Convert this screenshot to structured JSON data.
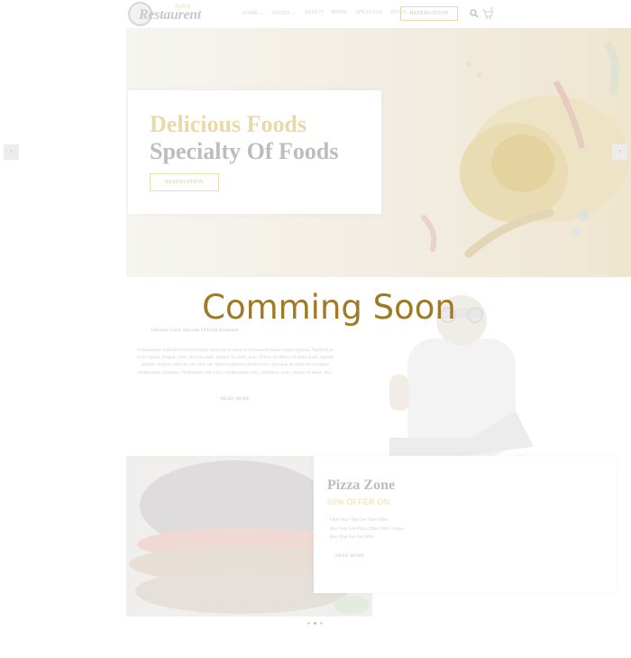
{
  "header": {
    "logo_text": "Restaurent",
    "logo_tag": "Spicy",
    "nav": [
      "HOME ⌄",
      "PAGES ⌄",
      "ABOUT",
      "MENU",
      "SPEACIAL",
      "NEWS"
    ],
    "reservation_label": "RESERVATION",
    "cart_count": "0",
    "icons": {
      "search": "search-icon",
      "cart": "cart-icon"
    }
  },
  "hero": {
    "title_line1": "Delicious Foods",
    "title_line2": "Specialty Of Foods",
    "button_label": "RESERVATION",
    "prev_arrow": "‹",
    "next_arrow": "›"
  },
  "overlay": {
    "coming_soon": "Comming Soon",
    "color": "#a07924"
  },
  "about": {
    "subtitle": "Delicious Foods, Specialty Of Foods Restaurent",
    "body": "Pellentesque habitant morbi tristique senectus et netus et malesuada fames turpis egestas. Vestibulum tortor quam, feugiat vitae, ultricies eget, tempor sit amet, ante. Donec eu libero sit amet quam egestas semper. Aenean ultricies mi vitae est. Mauris placerat eleifend leo. Quisque sit amet est et sapien ullamcorper pharetra. Vestibulum erat wisi, condimentum sed, commodo vitae, ornare sit amet, wisi.",
    "read_more": "READ MORE"
  },
  "promo": {
    "title": "Pizza Zone",
    "offer": "50% OFFER ON",
    "items": [
      "Only Buy One Get One Offer",
      "Buy One Get Pizza Offer Only 1 days",
      "Buy One Get On Offer"
    ],
    "read_more": "READ MORE",
    "slider_dots": 3,
    "active_dot": 2
  },
  "colors": {
    "accent": "#a07924",
    "accent_faded": "#ead9a8",
    "text_faded": "#bdbdbd"
  }
}
